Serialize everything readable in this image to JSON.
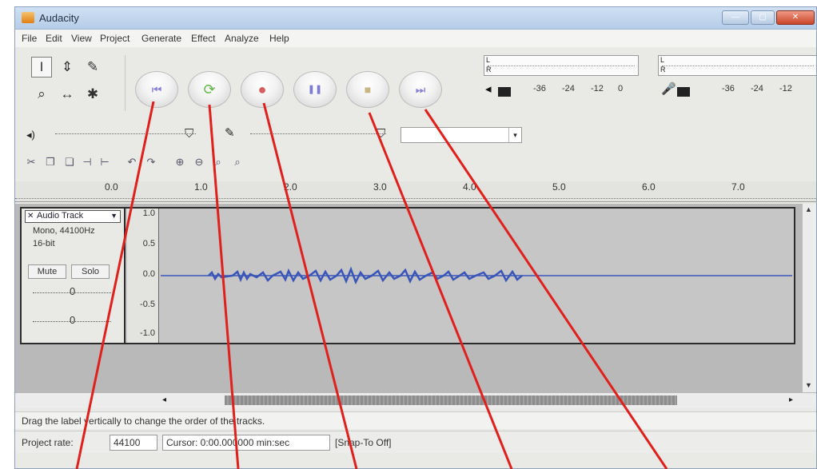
{
  "window": {
    "title": "Audacity"
  },
  "menu": [
    "File",
    "Edit",
    "View",
    "Project",
    "Generate",
    "Effect",
    "Analyze",
    "Help"
  ],
  "tools": [
    {
      "icon": "selection-tool-icon",
      "glyph": "I"
    },
    {
      "icon": "envelope-tool-icon",
      "glyph": "⇕"
    },
    {
      "icon": "draw-tool-icon",
      "glyph": "✎"
    },
    {
      "icon": "zoom-tool-icon",
      "glyph": "⌕"
    },
    {
      "icon": "timeshift-tool-icon",
      "glyph": "↔"
    },
    {
      "icon": "multi-tool-icon",
      "glyph": "✱"
    }
  ],
  "transport": [
    {
      "name": "skip-to-start-button",
      "icon": "skip-start-icon",
      "glyph": "⏮",
      "color": "#8a7fd8"
    },
    {
      "name": "play-button",
      "icon": "play-icon",
      "glyph": "⟳",
      "color": "#63b84e"
    },
    {
      "name": "record-button",
      "icon": "record-icon",
      "glyph": "●",
      "color": "#d55e63"
    },
    {
      "name": "pause-button",
      "icon": "pause-icon",
      "glyph": "❚❚",
      "color": "#7a7ad8"
    },
    {
      "name": "stop-button",
      "icon": "stop-icon",
      "glyph": "■",
      "color": "#c9b484"
    },
    {
      "name": "skip-to-end-button",
      "icon": "skip-end-icon",
      "glyph": "⏭",
      "color": "#8a7fd8"
    }
  ],
  "meters": {
    "output_ticks": [
      "-36",
      "-24",
      "-12",
      "0"
    ],
    "input_ticks": [
      "-36",
      "-24",
      "-12"
    ],
    "output_channel_labels": [
      "L",
      "R"
    ],
    "input_channel_labels": [
      "L",
      "R"
    ]
  },
  "ruler": {
    "ticks": [
      "0.0",
      "1.0",
      "2.0",
      "3.0",
      "4.0",
      "5.0",
      "6.0",
      "7.0"
    ]
  },
  "track": {
    "name": "Audio Track",
    "info_line1": "Mono, 44100Hz",
    "info_line2": "16-bit",
    "mute_label": "Mute",
    "solo_label": "Solo",
    "scale": [
      "1.0",
      "0.5",
      "0.0",
      "-0.5",
      "-1.0"
    ]
  },
  "status": {
    "message": "Drag the label vertically to change the order of the tracks.",
    "project_rate_label": "Project rate:",
    "project_rate_value": "44100",
    "cursor_label": "Cursor: 0:00.000000 min:sec",
    "snap_label": "[Snap-To Off]"
  },
  "colors": {
    "waveform": "#3a55b8",
    "annotation_line": "#e0201c"
  }
}
